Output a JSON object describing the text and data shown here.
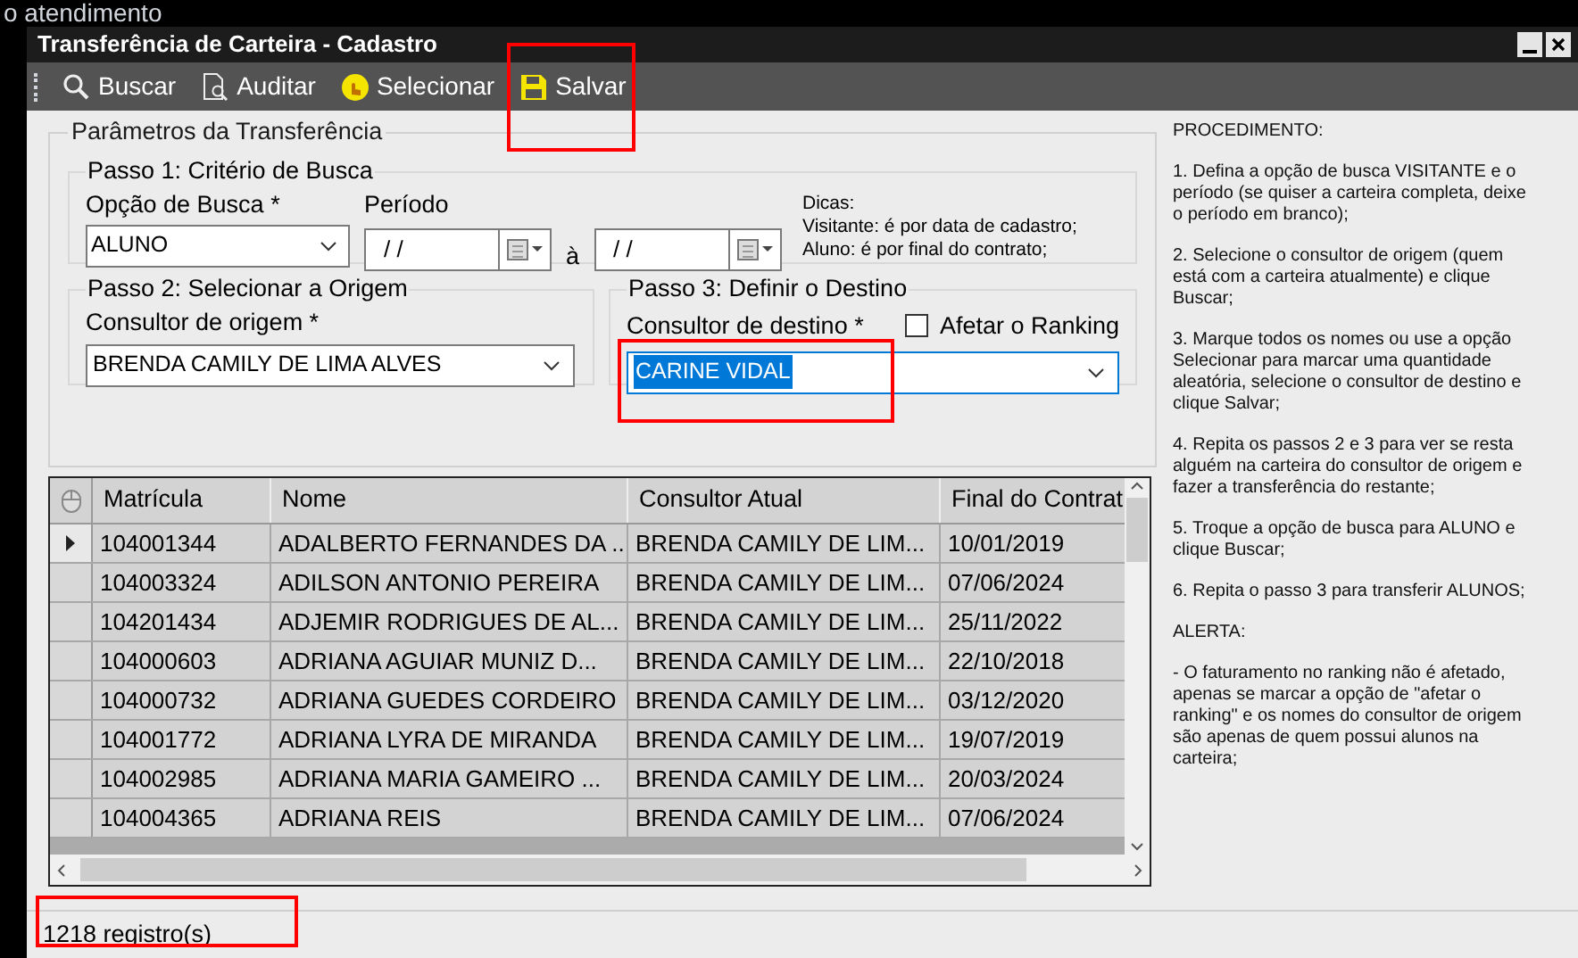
{
  "background": {
    "text": "o atendimento"
  },
  "window": {
    "title": "Transferência de Carteira - Cadastro"
  },
  "toolbar": [
    {
      "kind": "search",
      "label": "Buscar"
    },
    {
      "kind": "audit",
      "label": "Auditar"
    },
    {
      "kind": "select",
      "label": "Selecionar"
    },
    {
      "kind": "save",
      "label": "Salvar"
    }
  ],
  "parameters": {
    "title": "Parâmetros da Transferência",
    "step1": {
      "title": "Passo 1: Critério de Busca",
      "search_option": {
        "label": "Opção de Busca *",
        "value": "ALUNO"
      },
      "period": {
        "label": "Período",
        "from": "/ /",
        "separator": "à",
        "to": "/ /"
      },
      "tips": [
        "Dicas:",
        "Visitante: é por data de cadastro;",
        "Aluno: é por final do contrato;"
      ]
    },
    "step2": {
      "title": "Passo 2: Selecionar a Origem",
      "origin": {
        "label": "Consultor de origem *",
        "value": "BRENDA CAMILY DE LIMA ALVES"
      }
    },
    "step3": {
      "title": "Passo 3: Definir o Destino",
      "destination": {
        "label": "Consultor de destino *",
        "value": "CARINE VIDAL",
        "text_selected": true
      },
      "affect_ranking": {
        "label": "Afetar o Ranking",
        "checked": false
      }
    }
  },
  "table": {
    "columns": [
      "Matrícula",
      "Nome",
      "Consultor Atual",
      "Final do Contrat"
    ],
    "rows": [
      {
        "selected": true,
        "cells": [
          "104001344",
          "ADALBERTO FERNANDES DA ...",
          "BRENDA CAMILY DE LIM...",
          "10/01/2019"
        ]
      },
      {
        "selected": false,
        "cells": [
          "104003324",
          "ADILSON ANTONIO PEREIRA",
          "BRENDA CAMILY DE LIM...",
          "07/06/2024"
        ]
      },
      {
        "selected": false,
        "cells": [
          "104201434",
          "ADJEMIR RODRIGUES DE AL...",
          "BRENDA CAMILY DE LIM...",
          "25/11/2022"
        ]
      },
      {
        "selected": false,
        "cells": [
          "104000603",
          "ADRIANA AGUIAR MUNIZ D...",
          "BRENDA CAMILY DE LIM...",
          "22/10/2018"
        ]
      },
      {
        "selected": false,
        "cells": [
          "104000732",
          "ADRIANA GUEDES CORDEIRO",
          "BRENDA CAMILY DE LIM...",
          "03/12/2020"
        ]
      },
      {
        "selected": false,
        "cells": [
          "104001772",
          "ADRIANA LYRA DE MIRANDA",
          "BRENDA CAMILY DE LIM...",
          "19/07/2019"
        ]
      },
      {
        "selected": false,
        "cells": [
          "104002985",
          "ADRIANA MARIA GAMEIRO ...",
          "BRENDA CAMILY DE LIM...",
          "20/03/2024"
        ]
      },
      {
        "selected": false,
        "cells": [
          "104004365",
          "ADRIANA REIS",
          "BRENDA CAMILY DE LIM...",
          "07/06/2024"
        ]
      }
    ]
  },
  "procedure": [
    "PROCEDIMENTO:",
    "1. Defina a opção de busca VISITANTE e o período (se quiser a carteira completa, deixe o período em branco);",
    "2. Selecione o consultor de origem (quem está com a carteira atualmente) e clique Buscar;",
    "3. Marque todos os nomes ou use a opção Selecionar para marcar uma quantidade aleatória, selecione o consultor de destino e clique Salvar;",
    "4. Repita os passos 2 e 3 para ver se resta alguém na carteira do consultor de origem e fazer a transferência do restante;",
    "5. Troque a opção de busca para ALUNO e clique Buscar;",
    "6. Repita o passo 3 para transferir ALUNOS;",
    "ALERTA:",
    "- O faturamento no ranking não é afetado, apenas se marcar a opção de \"afetar o ranking\" e os nomes do consultor de origem são apenas de quem possui alunos na carteira;"
  ],
  "status_bar": {
    "text": "1218 registro(s)"
  }
}
